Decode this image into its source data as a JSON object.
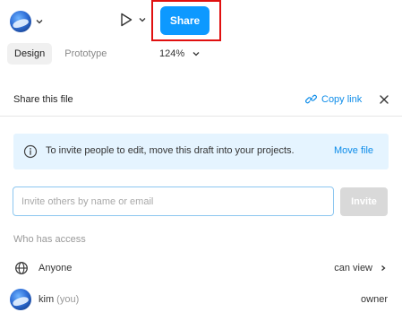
{
  "toolbar": {
    "share_label": "Share"
  },
  "tabs": [
    {
      "label": "Design",
      "active": true
    },
    {
      "label": "Prototype",
      "active": false
    }
  ],
  "zoom": {
    "value": "124%"
  },
  "share_panel": {
    "title": "Share this file",
    "copy_link_label": "Copy link",
    "info_message": "To invite people to edit, move this draft into your projects.",
    "move_file_label": "Move file",
    "invite_placeholder": "Invite others by name or email",
    "invite_button": "Invite",
    "access_heading": "Who has access",
    "access_list": [
      {
        "name": "Anyone",
        "permission": "can view"
      },
      {
        "name": "kim",
        "suffix": "(you)",
        "permission": "owner"
      }
    ]
  },
  "colors": {
    "accent": "#0d99ff",
    "link": "#0d8ce9",
    "banner_bg": "#e5f4ff",
    "highlight": "#e01010"
  },
  "icons": [
    "avatar",
    "chevron-down-icon",
    "play-icon",
    "link-icon",
    "close-icon",
    "info-icon",
    "globe-icon",
    "chevron-right-icon"
  ]
}
